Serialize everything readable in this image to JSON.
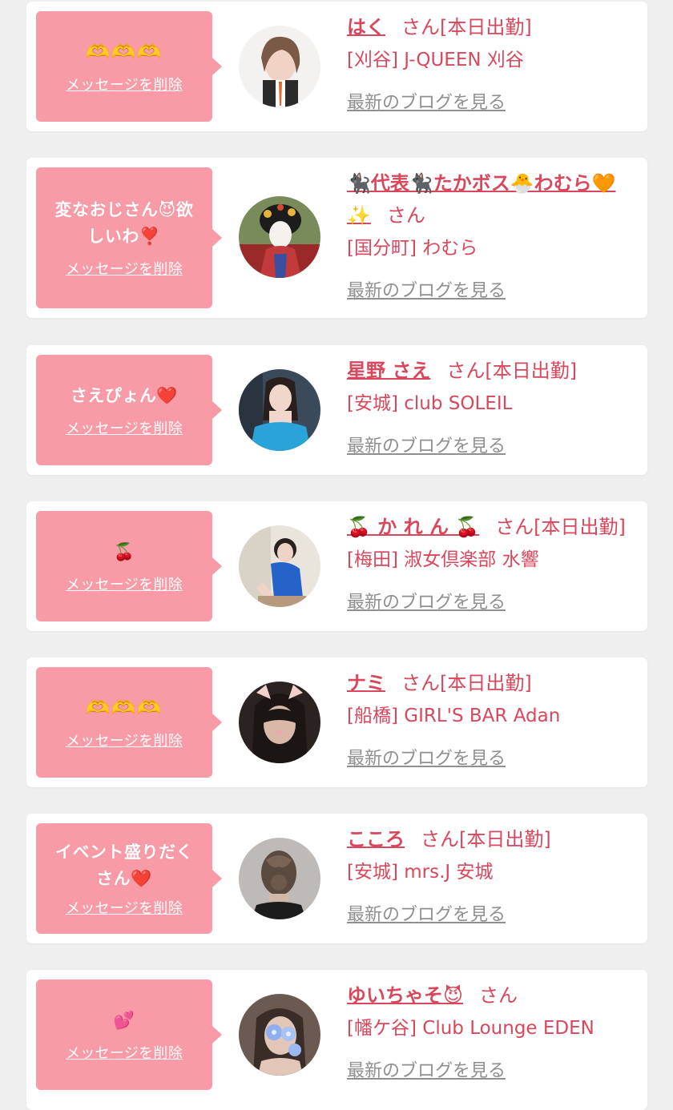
{
  "colors": {
    "accent": "#d9475c",
    "bubble": "#f89ba7",
    "muted": "#8f8f8f",
    "background": "#efefef"
  },
  "delete_label": "メッセージを削除",
  "blog_label": "最新のブログを見る",
  "entries": [
    {
      "message": "🫶🫶🫶",
      "name": "はく",
      "suffix": "さん[本日出勤]",
      "shop": "[刈谷] J-QUEEN 刈谷",
      "avatar_icon": "woman-portrait-avatar"
    },
    {
      "message": "変なおじさん😈欲しいわ❣️",
      "name": "🐈‍⬛代表🐈‍⬛たかボス🐣わむら🧡✨",
      "suffix": "さん",
      "shop": "[国分町] わむら",
      "avatar_icon": "oiran-portrait-avatar"
    },
    {
      "message": "さえぴょん❤️",
      "name": "星野 さえ",
      "suffix": "さん[本日出勤]",
      "shop": "[安城] club SOLEIL",
      "avatar_icon": "woman-blue-dress-avatar"
    },
    {
      "message": "🍒",
      "name": "🍒 か れ ん 🍒",
      "suffix": "さん[本日出勤]",
      "shop": "[梅田] 淑女倶楽部 水響",
      "avatar_icon": "woman-seated-avatar"
    },
    {
      "message": "🫶🫶🫶",
      "name": "ナミ",
      "suffix": "さん[本日出勤]",
      "shop": "[船橋] GIRL'S BAR Adan",
      "avatar_icon": "woman-cat-filter-avatar"
    },
    {
      "message": "イベント盛りだくさん❤️",
      "name": "こころ",
      "suffix": "さん[本日出勤]",
      "shop": "[安城] mrs.J 安城",
      "avatar_icon": "hairstyle-back-avatar"
    },
    {
      "message": "💕",
      "name": "ゆいちゃそ😈",
      "suffix": "さん",
      "shop": "[幡ケ谷] Club Lounge EDEN",
      "avatar_icon": "woman-flower-avatar"
    }
  ]
}
